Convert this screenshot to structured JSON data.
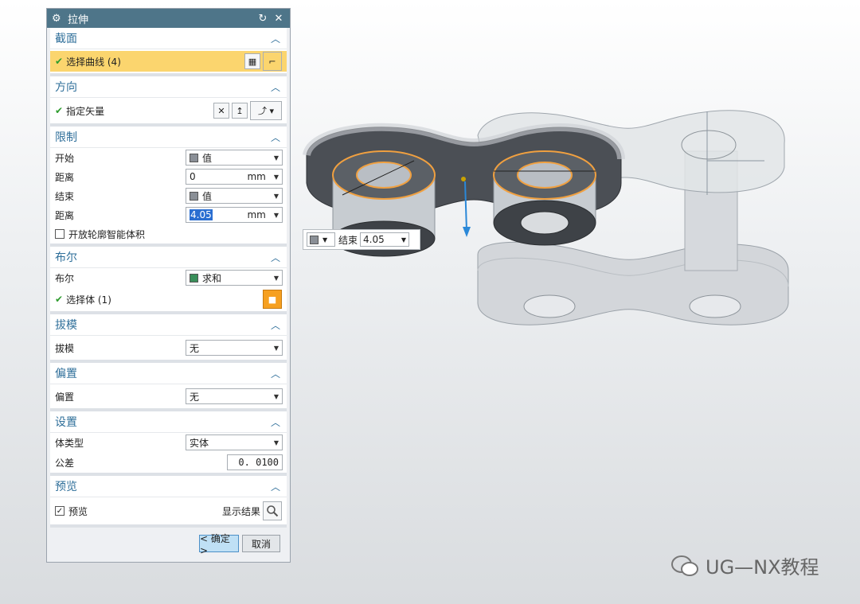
{
  "dialog": {
    "title": "拉伸",
    "sections": {
      "section": {
        "title": "截面",
        "select_curve": "选择曲线 (4)"
      },
      "direction": {
        "title": "方向",
        "specify_vector": "指定矢量"
      },
      "limits": {
        "title": "限制",
        "start_label": "开始",
        "start_value": "值",
        "distance1_label": "距离",
        "distance1_value": "0",
        "distance1_unit": "mm",
        "end_label": "结束",
        "end_value": "值",
        "distance2_label": "距离",
        "distance2_value": "4.05",
        "distance2_unit": "mm",
        "open_profile_label": "开放轮廓智能体积"
      },
      "boolean": {
        "title": "布尔",
        "boolean_label": "布尔",
        "boolean_value": "求和",
        "select_body": "选择体 (1)"
      },
      "draft": {
        "title": "拔模",
        "draft_label": "拔模",
        "draft_value": "无"
      },
      "offset": {
        "title": "偏置",
        "offset_label": "偏置",
        "offset_value": "无"
      },
      "settings": {
        "title": "设置",
        "body_type_label": "体类型",
        "body_type_value": "实体",
        "tolerance_label": "公差",
        "tolerance_value": "0. 0100"
      },
      "preview": {
        "title": "预览",
        "preview_label": "预览",
        "show_result_label": "显示结果"
      }
    },
    "buttons": {
      "ok": "< 确定 >",
      "cancel": "取消"
    }
  },
  "floating_input": {
    "label": "结束",
    "value": "4.05"
  },
  "watermark": {
    "text": "UG—NX教程"
  },
  "colors": {
    "title_bar": "#4e7589",
    "section_title": "#2f6f9a",
    "highlight": "#fbd56e",
    "model_edge": "#f0a040",
    "vector": "#2a88d8"
  }
}
